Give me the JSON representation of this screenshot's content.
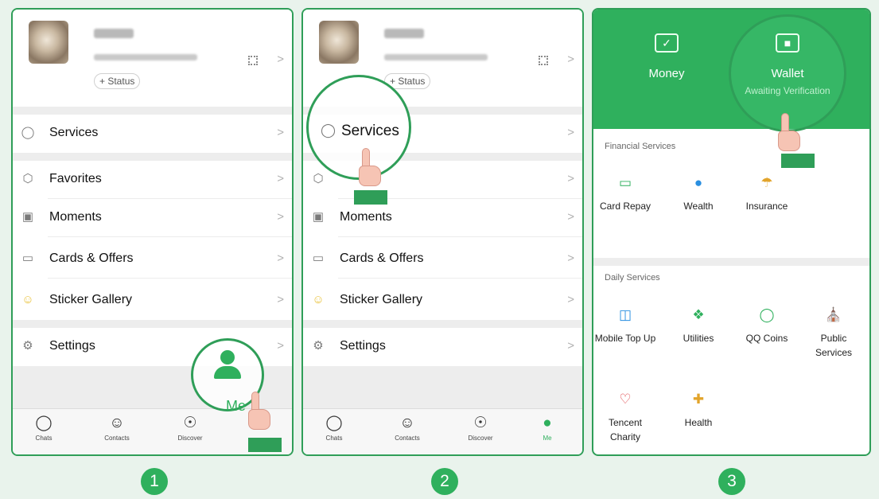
{
  "profile": {
    "status_label": "+ Status"
  },
  "menu": {
    "services": "Services",
    "favorites": "Favorites",
    "moments": "Moments",
    "cards_offers": "Cards & Offers",
    "sticker_gallery": "Sticker Gallery",
    "settings": "Settings"
  },
  "tabs": {
    "chats": "Chats",
    "contacts": "Contacts",
    "discover": "Discover",
    "me": "Me"
  },
  "steps": [
    "1",
    "2",
    "3"
  ],
  "wallet_page": {
    "money_label": "Money",
    "wallet_label": "Wallet",
    "wallet_status": "Awaiting Verification",
    "financial_title": "Financial Services",
    "financial_items": [
      "Card Repay",
      "Wealth",
      "Insurance"
    ],
    "daily_title": "Daily Services",
    "daily_items": [
      "Mobile Top Up",
      "Utilities",
      "QQ Coins",
      "Public Services",
      "Tencent Charity",
      "Health"
    ]
  },
  "colors": {
    "accent": "#2fb05d",
    "accent_dark": "#2f9e58",
    "background": "#e9f3ec",
    "separator": "#ededed"
  },
  "icons": {
    "services": "check-circle-icon",
    "favorites": "cube-icon",
    "moments": "image-icon",
    "cards_offers": "card-icon",
    "sticker_gallery": "smile-icon",
    "settings": "gear-icon",
    "chats": "chat-bubble-icon",
    "contacts": "contacts-icon",
    "discover": "compass-icon",
    "me": "person-icon"
  }
}
